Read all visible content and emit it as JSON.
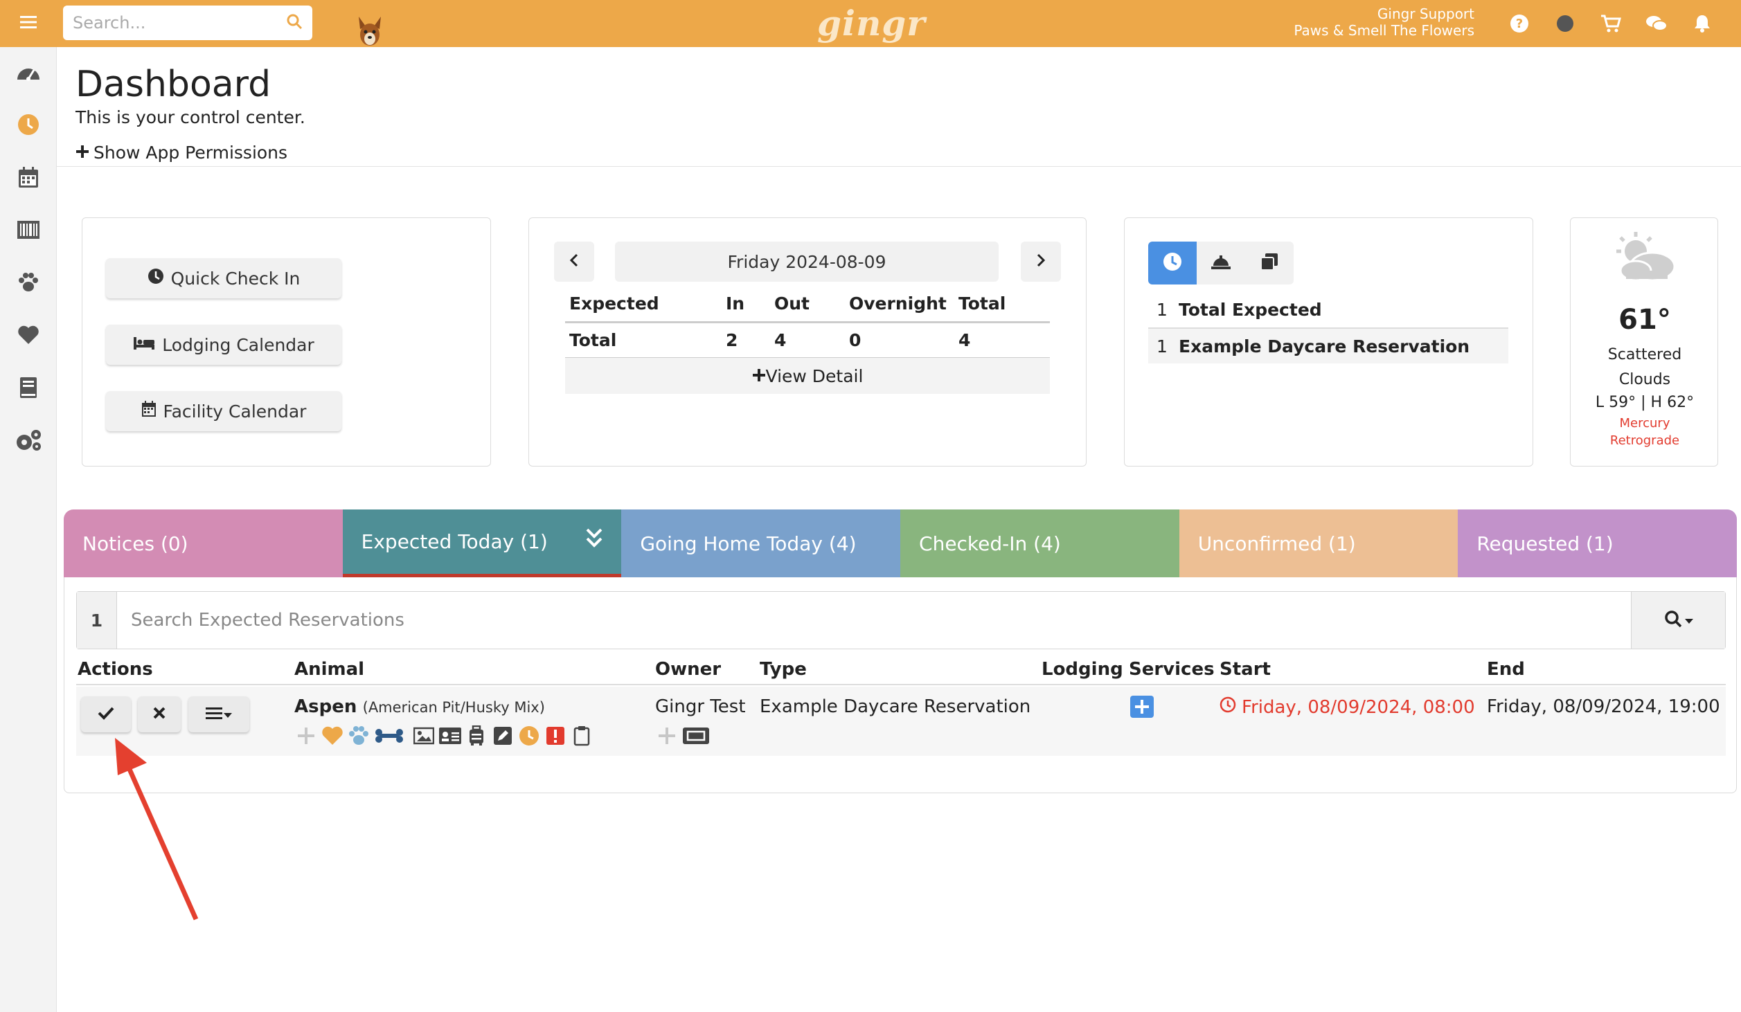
{
  "header": {
    "search_placeholder": "Search...",
    "brand": "gingr",
    "user_name": "Gingr Support",
    "location": "Paws & Smell The Flowers"
  },
  "page": {
    "title": "Dashboard",
    "subtitle": "This is your control center.",
    "permissions_link": "Show App Permissions"
  },
  "quick_actions": {
    "check_in": "Quick Check In",
    "lodging": "Lodging Calendar",
    "facility": "Facility Calendar"
  },
  "stats": {
    "date": "Friday 2024-08-09",
    "headers": [
      "Expected",
      "In",
      "Out",
      "Overnight",
      "Total"
    ],
    "total_row": [
      "Total",
      "2",
      "4",
      "0",
      "4"
    ],
    "view_detail": "View Detail"
  },
  "expected_card": {
    "rows": [
      {
        "count": "1",
        "label": "Total Expected"
      },
      {
        "count": "1",
        "label": "Example Daycare Reservation"
      }
    ]
  },
  "weather": {
    "temp": "61°",
    "condition": "Scattered Clouds",
    "range": "L 59° | H 62°",
    "note": "Mercury Retrograde"
  },
  "tabs": [
    {
      "label": "Notices (0)",
      "color": "#d38cb4"
    },
    {
      "label": "Expected Today (1)",
      "color": "#4f8f96"
    },
    {
      "label": "Going Home Today (4)",
      "color": "#7aa1cc"
    },
    {
      "label": "Checked-In (4)",
      "color": "#89b57e"
    },
    {
      "label": "Unconfirmed (1)",
      "color": "#edbf94"
    },
    {
      "label": "Requested (1)",
      "color": "#c292ca"
    }
  ],
  "reservations": {
    "count": "1",
    "search_placeholder": "Search Expected Reservations",
    "columns": [
      "Actions",
      "Animal",
      "Owner",
      "Type",
      "Lodging",
      "Services",
      "Start",
      "End"
    ],
    "rows": [
      {
        "animal": "Aspen",
        "breed": "(American Pit/Husky Mix)",
        "owner": "Gingr Test",
        "type": "Example Daycare Reservation",
        "lodging": "",
        "start": "Friday, 08/09/2024, 08:00",
        "end": "Friday, 08/09/2024, 19:00"
      }
    ]
  }
}
